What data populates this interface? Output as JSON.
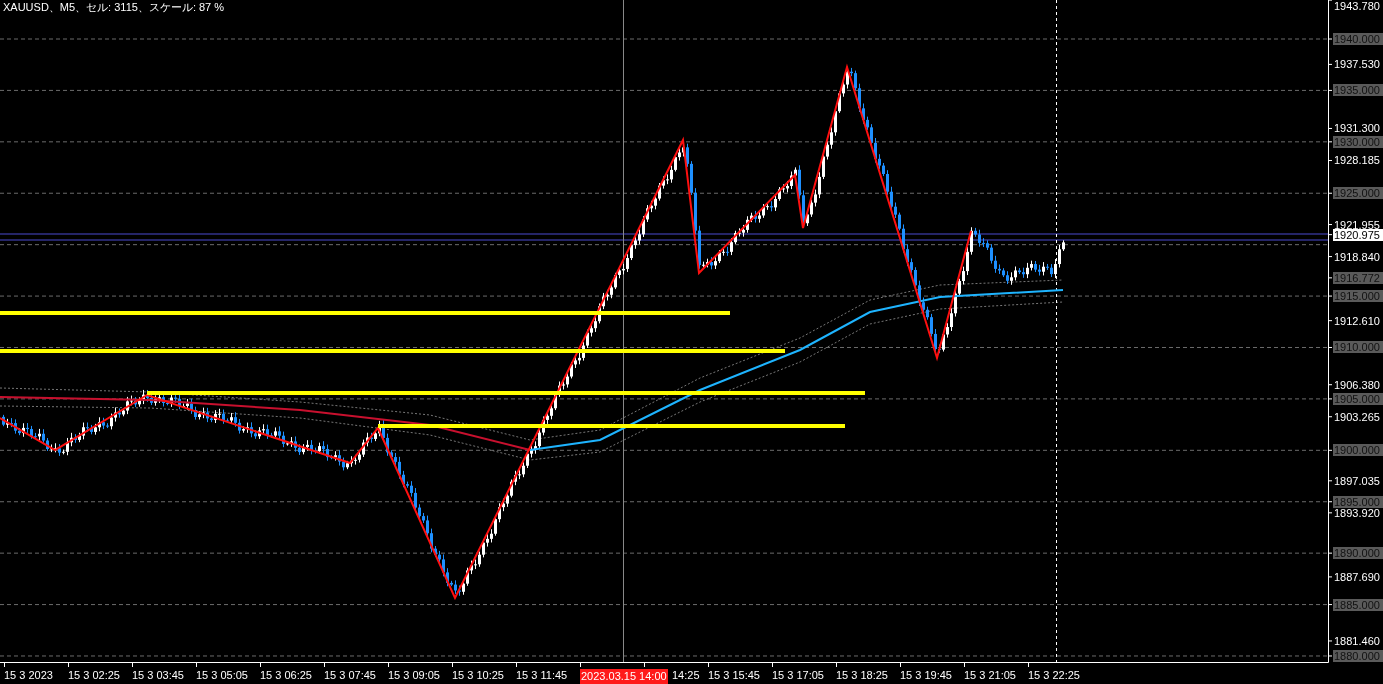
{
  "title": "XAUUSD、M5、セル: 3115、スケール: 87 %",
  "price_axis": {
    "labels": [
      {
        "text": "1943.780",
        "kind": "tick"
      },
      {
        "text": "1940.000",
        "kind": "level"
      },
      {
        "text": "1937.530",
        "kind": "tick"
      },
      {
        "text": "1935.000",
        "kind": "level"
      },
      {
        "text": "1931.300",
        "kind": "tick"
      },
      {
        "text": "1930.000",
        "kind": "level"
      },
      {
        "text": "1928.185",
        "kind": "tick"
      },
      {
        "text": "1925.000",
        "kind": "level"
      },
      {
        "text": "1921.955",
        "kind": "tick"
      },
      {
        "text": "1920.975",
        "kind": "current"
      },
      {
        "text": "1918.840",
        "kind": "tick"
      },
      {
        "text": "1916.772",
        "kind": "level"
      },
      {
        "text": "1915.000",
        "kind": "level"
      },
      {
        "text": "1912.610",
        "kind": "tick"
      },
      {
        "text": "1910.000",
        "kind": "level"
      },
      {
        "text": "1906.380",
        "kind": "tick"
      },
      {
        "text": "1905.000",
        "kind": "level"
      },
      {
        "text": "1903.265",
        "kind": "tick"
      },
      {
        "text": "1900.000",
        "kind": "level"
      },
      {
        "text": "1897.035",
        "kind": "tick"
      },
      {
        "text": "1895.000",
        "kind": "level"
      },
      {
        "text": "1893.920",
        "kind": "tick"
      },
      {
        "text": "1890.000",
        "kind": "level"
      },
      {
        "text": "1887.690",
        "kind": "tick"
      },
      {
        "text": "1885.000",
        "kind": "level"
      },
      {
        "text": "1881.460",
        "kind": "tick"
      },
      {
        "text": "1880.000",
        "kind": "level"
      }
    ]
  },
  "time_axis": {
    "labels": [
      "15 3 2023",
      "15 3 02:25",
      "15 3 03:45",
      "15 3 05:05",
      "15 3 06:25",
      "15 3 07:45",
      "15 3 09:05",
      "15 3 10:25",
      "15 3 11:45",
      "14:25",
      "15 3 15:45",
      "15 3 17:05",
      "15 3 18:25",
      "15 3 19:45",
      "15 3 21:05",
      "15 3 22:25"
    ],
    "crosshair_label": "2023.03.15 14:00"
  }
}
